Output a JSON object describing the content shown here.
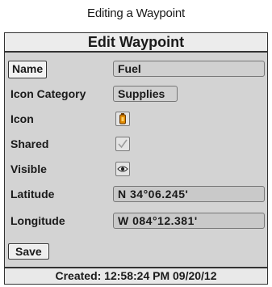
{
  "caption": "Editing a Waypoint",
  "dialog": {
    "title": "Edit Waypoint",
    "fields": {
      "name": {
        "label": "Name",
        "value": "Fuel"
      },
      "icon_category": {
        "label": "Icon Category",
        "value": "Supplies"
      },
      "icon": {
        "label": "Icon",
        "icon_name": "fuel-canister-icon"
      },
      "shared": {
        "label": "Shared",
        "icon_name": "checkbox-checked-icon"
      },
      "visible": {
        "label": "Visible",
        "icon_name": "eye-icon"
      },
      "latitude": {
        "label": "Latitude",
        "value": "N 34°06.245'"
      },
      "longitude": {
        "label": "Longitude",
        "value": "W 084°12.381'"
      }
    },
    "save_label": "Save",
    "footer": "Created: 12:58:24 PM 09/20/12"
  },
  "colors": {
    "panel_bg": "#d3d3d3",
    "border": "#333333",
    "icon_orange": "#e08a00"
  }
}
